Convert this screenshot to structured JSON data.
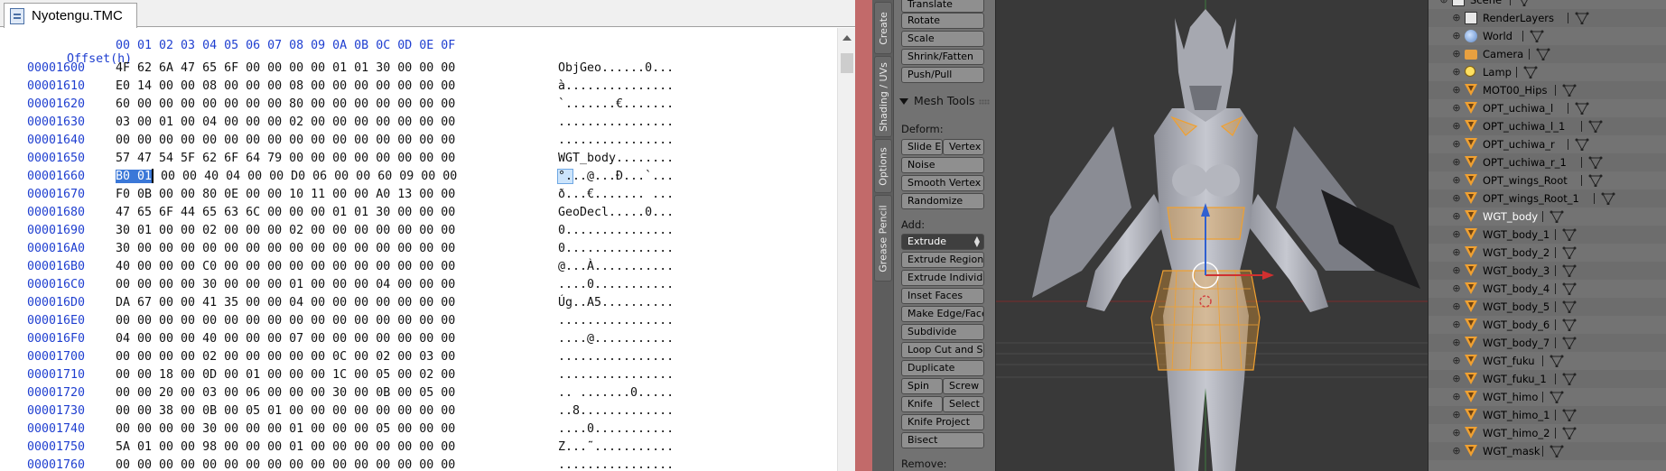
{
  "hex_editor": {
    "tab_title": "Nyotengu.TMC",
    "header_label": "Offset(h)",
    "header_bytes": "00 01 02 03 04 05 06 07 08 09 0A 0B 0C 0D 0E 0F",
    "rows": [
      {
        "addr": "00001600",
        "bytes": "4F 62 6A 47 65 6F 00 00 00 00 01 01 30 00 00 00",
        "ascii": "ObjGeo......0..."
      },
      {
        "addr": "00001610",
        "bytes": "E0 14 00 00 08 00 00 00 08 00 00 00 00 00 00 00",
        "ascii": "à..............."
      },
      {
        "addr": "00001620",
        "bytes": "60 00 00 00 00 00 00 00 80 00 00 00 00 00 00 00",
        "ascii": "`.......€......."
      },
      {
        "addr": "00001630",
        "bytes": "03 00 01 00 04 00 00 00 02 00 00 00 00 00 00 00",
        "ascii": "................"
      },
      {
        "addr": "00001640",
        "bytes": "00 00 00 00 00 00 00 00 00 00 00 00 00 00 00 00",
        "ascii": "................"
      },
      {
        "addr": "00001650",
        "bytes": "57 47 54 5F 62 6F 64 79 00 00 00 00 00 00 00 00",
        "ascii": "WGT_body........"
      },
      {
        "addr": "00001660",
        "bytes_sel": "B0 01",
        "bytes_rest": " 00 00 40 04 00 00 D0 06 00 00 60 09 00 00",
        "ascii_sel": "°.",
        "ascii_rest": "..@...Ð...`..."
      },
      {
        "addr": "00001670",
        "bytes": "F0 0B 00 00 80 0E 00 00 10 11 00 00 A0 13 00 00",
        "ascii": "ð...€....... ..."
      },
      {
        "addr": "00001680",
        "bytes": "47 65 6F 44 65 63 6C 00 00 00 01 01 30 00 00 00",
        "ascii": "GeoDecl.....0..."
      },
      {
        "addr": "00001690",
        "bytes": "30 01 00 00 02 00 00 00 02 00 00 00 00 00 00 00",
        "ascii": "0..............."
      },
      {
        "addr": "000016A0",
        "bytes": "30 00 00 00 00 00 00 00 00 00 00 00 00 00 00 00",
        "ascii": "0..............."
      },
      {
        "addr": "000016B0",
        "bytes": "40 00 00 00 C0 00 00 00 00 00 00 00 00 00 00 00",
        "ascii": "@...À..........."
      },
      {
        "addr": "000016C0",
        "bytes": "00 00 00 00 30 00 00 00 01 00 00 00 04 00 00 00",
        "ascii": "....0..........."
      },
      {
        "addr": "000016D0",
        "bytes": "DA 67 00 00 41 35 00 00 04 00 00 00 00 00 00 00",
        "ascii": "Úg..A5.........."
      },
      {
        "addr": "000016E0",
        "bytes": "00 00 00 00 00 00 00 00 00 00 00 00 00 00 00 00",
        "ascii": "................"
      },
      {
        "addr": "000016F0",
        "bytes": "04 00 00 00 40 00 00 00 07 00 00 00 00 00 00 00",
        "ascii": "....@..........."
      },
      {
        "addr": "00001700",
        "bytes": "00 00 00 00 02 00 00 00 00 00 0C 00 02 00 03 00",
        "ascii": "................"
      },
      {
        "addr": "00001710",
        "bytes": "00 00 18 00 0D 00 01 00 00 00 1C 00 05 00 02 00",
        "ascii": "................"
      },
      {
        "addr": "00001720",
        "bytes": "00 00 20 00 03 00 06 00 00 00 30 00 0B 00 05 00",
        "ascii": ".. .......0....."
      },
      {
        "addr": "00001730",
        "bytes": "00 00 38 00 0B 00 05 01 00 00 00 00 00 00 00 00",
        "ascii": "..8............."
      },
      {
        "addr": "00001740",
        "bytes": "00 00 00 00 30 00 00 00 01 00 00 00 05 00 00 00",
        "ascii": "....0..........."
      },
      {
        "addr": "00001750",
        "bytes": "5A 01 00 00 98 00 00 00 01 00 00 00 00 00 00 00",
        "ascii": "Z...˜..........."
      },
      {
        "addr": "00001760",
        "bytes": "00 00 00 00 00 00 00 00 00 00 00 00 00 00 00 00",
        "ascii": "................"
      }
    ]
  },
  "tool_shelf": {
    "vertical_tabs": [
      "Create",
      "Shading / UVs",
      "Options",
      "Grease Pencil"
    ],
    "transform_buttons": [
      "Translate",
      "Rotate",
      "Scale",
      "Shrink/Fatten",
      "Push/Pull"
    ],
    "mesh_tools_title": "Mesh Tools",
    "deform_label": "Deform:",
    "deform_buttons": {
      "slide_edge": "Slide Ed",
      "vertex": "Vertex",
      "noise": "Noise",
      "smooth_vertex": "Smooth Vertex",
      "randomize": "Randomize"
    },
    "add_label": "Add:",
    "extrude_select": "Extrude",
    "add_buttons": [
      "Extrude Region",
      "Extrude Individual",
      "Inset Faces",
      "Make Edge/Face",
      "Subdivide",
      "Loop Cut and Slide",
      "Duplicate"
    ],
    "spin": "Spin",
    "screw": "Screw",
    "knife": "Knife",
    "select": "Select",
    "knife_project": "Knife Project",
    "bisect": "Bisect",
    "remove_label": "Remove:"
  },
  "outliner": {
    "items": [
      {
        "label": "Scene",
        "icon": "scene-icon",
        "indent": 0
      },
      {
        "label": "RenderLayers",
        "icon": "render-layers-icon",
        "indent": 1
      },
      {
        "label": "World",
        "icon": "world-icon",
        "indent": 1
      },
      {
        "label": "Camera",
        "icon": "camera-icon",
        "indent": 1
      },
      {
        "label": "Lamp",
        "icon": "lamp-icon",
        "indent": 1
      },
      {
        "label": "MOT00_Hips",
        "icon": "mesh-object-icon",
        "indent": 1
      },
      {
        "label": "OPT_uchiwa_l",
        "icon": "mesh-object-icon",
        "indent": 1
      },
      {
        "label": "OPT_uchiwa_l_1",
        "icon": "mesh-object-icon",
        "indent": 1
      },
      {
        "label": "OPT_uchiwa_r",
        "icon": "mesh-object-icon",
        "indent": 1
      },
      {
        "label": "OPT_uchiwa_r_1",
        "icon": "mesh-object-icon",
        "indent": 1
      },
      {
        "label": "OPT_wings_Root",
        "icon": "mesh-object-icon",
        "indent": 1
      },
      {
        "label": "OPT_wings_Root_1",
        "icon": "mesh-object-icon",
        "indent": 1
      },
      {
        "label": "WGT_body",
        "icon": "mesh-object-icon",
        "indent": 1,
        "selected": true
      },
      {
        "label": "WGT_body_1",
        "icon": "mesh-object-icon",
        "indent": 1
      },
      {
        "label": "WGT_body_2",
        "icon": "mesh-object-icon",
        "indent": 1
      },
      {
        "label": "WGT_body_3",
        "icon": "mesh-object-icon",
        "indent": 1
      },
      {
        "label": "WGT_body_4",
        "icon": "mesh-object-icon",
        "indent": 1
      },
      {
        "label": "WGT_body_5",
        "icon": "mesh-object-icon",
        "indent": 1
      },
      {
        "label": "WGT_body_6",
        "icon": "mesh-object-icon",
        "indent": 1
      },
      {
        "label": "WGT_body_7",
        "icon": "mesh-object-icon",
        "indent": 1
      },
      {
        "label": "WGT_fuku",
        "icon": "mesh-object-icon",
        "indent": 1
      },
      {
        "label": "WGT_fuku_1",
        "icon": "mesh-object-icon",
        "indent": 1
      },
      {
        "label": "WGT_himo",
        "icon": "mesh-object-icon",
        "indent": 1
      },
      {
        "label": "WGT_himo_1",
        "icon": "mesh-object-icon",
        "indent": 1
      },
      {
        "label": "WGT_himo_2",
        "icon": "mesh-object-icon",
        "indent": 1
      },
      {
        "label": "WGT_mask",
        "icon": "mesh-object-icon",
        "indent": 1
      }
    ]
  },
  "colors": {
    "hex_address_blue": "#1f3fd0",
    "selection_highlight": "#cce4fb",
    "divider_red": "#c26a6a",
    "blender_panel": "#727272",
    "viewport_bg": "#393939",
    "mesh_selection_orange": "#f0a030",
    "x_axis_red": "#d03030",
    "y_axis_green": "#40a040",
    "z_axis_blue": "#3060d0"
  }
}
